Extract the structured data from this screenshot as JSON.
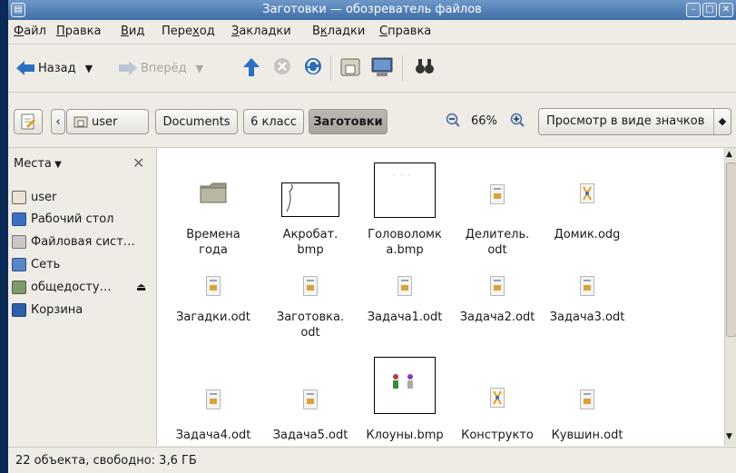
{
  "window": {
    "title": "Заготовки — обозреватель файлов"
  },
  "menu": {
    "items": [
      {
        "pre": "",
        "key": "Ф",
        "post": "айл"
      },
      {
        "pre": "",
        "key": "П",
        "post": "равка"
      },
      {
        "pre": "",
        "key": "В",
        "post": "ид"
      },
      {
        "pre": "Пере",
        "key": "х",
        "post": "од"
      },
      {
        "pre": "",
        "key": "З",
        "post": "акладки"
      },
      {
        "pre": "В",
        "key": "к",
        "post": "ладки"
      },
      {
        "pre": "",
        "key": "С",
        "post": "правка"
      }
    ]
  },
  "toolbar": {
    "back_label": "Назад",
    "forward_label": "Вперёд"
  },
  "location": {
    "path": [
      "user",
      "Documents",
      "6 класс",
      "Заготовки"
    ],
    "zoom": "66%",
    "view_mode": "Просмотр в виде значков"
  },
  "sidebar": {
    "header": "Места",
    "places": [
      "user",
      "Рабочий стол",
      "Файловая сист…",
      "Сеть",
      "общедосту…",
      "Корзина"
    ]
  },
  "files": [
    {
      "name": "Времена\nгода",
      "icon": "folder-icon"
    },
    {
      "name": "Акробат.\nbmp",
      "icon": "image-icon"
    },
    {
      "name": "Головоломк\nа.bmp",
      "icon": "image-icon"
    },
    {
      "name": "Делитель.\nodt",
      "icon": "document-icon"
    },
    {
      "name": "Домик.odg",
      "icon": "drawing-icon"
    },
    {
      "name": "Загадки.odt",
      "icon": "document-icon"
    },
    {
      "name": "Заготовка.\nodt",
      "icon": "document-icon"
    },
    {
      "name": "Задача1.odt",
      "icon": "document-icon"
    },
    {
      "name": "Задача2.odt",
      "icon": "document-icon"
    },
    {
      "name": "Задача3.odt",
      "icon": "document-icon"
    },
    {
      "name": "Задача4.odt",
      "icon": "document-icon"
    },
    {
      "name": "Задача5.odt",
      "icon": "document-icon"
    },
    {
      "name": "Клоуны.bmp",
      "icon": "image-icon"
    },
    {
      "name": "Конструкто",
      "icon": "drawing-icon"
    },
    {
      "name": "Кувшин.odt",
      "icon": "document-icon"
    }
  ],
  "status": {
    "text": "22 объекта, свободно: 3,6 ГБ"
  },
  "colors": {
    "titlebar": "#3f6ea6",
    "selection": "#a8a49c"
  }
}
